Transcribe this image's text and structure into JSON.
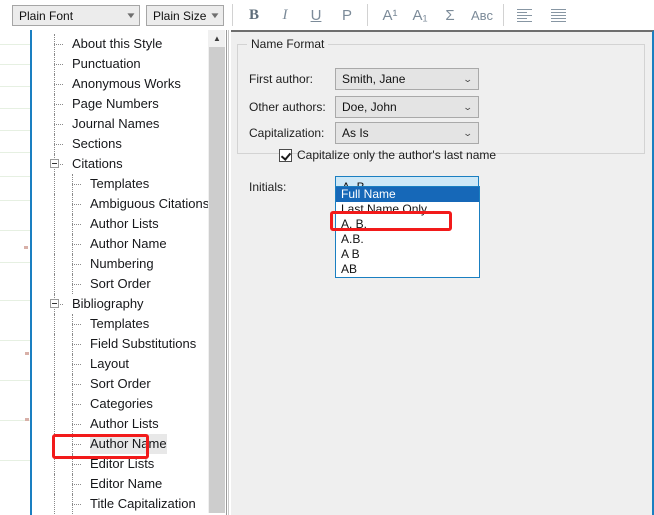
{
  "toolbar": {
    "font_combo": {
      "value": "Plain Font",
      "arrow": "dropdown-arrow-icon"
    },
    "size_combo": {
      "value": "Plain Size",
      "arrow": "dropdown-arrow-icon"
    },
    "buttons": [
      {
        "name": "bold-button",
        "label": "B"
      },
      {
        "name": "italic-button",
        "label": "I"
      },
      {
        "name": "underline-button",
        "label": "U"
      },
      {
        "name": "plain-button",
        "label": "P"
      },
      {
        "name": "superscript-button",
        "label": "A¹"
      },
      {
        "name": "subscript-button",
        "label": "A₁"
      },
      {
        "name": "symbol-button",
        "label": "Σ"
      },
      {
        "name": "spellcheck-button",
        "label": "Aʙᴄ"
      },
      {
        "name": "align-left-button",
        "label": ""
      },
      {
        "name": "align-justify-button",
        "label": ""
      }
    ]
  },
  "tree": {
    "items": [
      {
        "label": "About this Style",
        "level": 1,
        "expander": false,
        "selected": false
      },
      {
        "label": "Punctuation",
        "level": 1,
        "expander": false,
        "selected": false
      },
      {
        "label": "Anonymous Works",
        "level": 1,
        "expander": false,
        "selected": false
      },
      {
        "label": "Page Numbers",
        "level": 1,
        "expander": false,
        "selected": false
      },
      {
        "label": "Journal Names",
        "level": 1,
        "expander": false,
        "selected": false
      },
      {
        "label": "Sections",
        "level": 1,
        "expander": false,
        "selected": false
      },
      {
        "label": "Citations",
        "level": 1,
        "expander": true,
        "selected": false
      },
      {
        "label": "Templates",
        "level": 2,
        "expander": false,
        "selected": false
      },
      {
        "label": "Ambiguous Citations",
        "level": 2,
        "expander": false,
        "selected": false
      },
      {
        "label": "Author Lists",
        "level": 2,
        "expander": false,
        "selected": false
      },
      {
        "label": "Author Name",
        "level": 2,
        "expander": false,
        "selected": false
      },
      {
        "label": "Numbering",
        "level": 2,
        "expander": false,
        "selected": false
      },
      {
        "label": "Sort Order",
        "level": 2,
        "expander": false,
        "selected": false
      },
      {
        "label": "Bibliography",
        "level": 1,
        "expander": true,
        "selected": false
      },
      {
        "label": "Templates",
        "level": 2,
        "expander": false,
        "selected": false
      },
      {
        "label": "Field Substitutions",
        "level": 2,
        "expander": false,
        "selected": false
      },
      {
        "label": "Layout",
        "level": 2,
        "expander": false,
        "selected": false
      },
      {
        "label": "Sort Order",
        "level": 2,
        "expander": false,
        "selected": false
      },
      {
        "label": "Categories",
        "level": 2,
        "expander": false,
        "selected": false
      },
      {
        "label": "Author Lists",
        "level": 2,
        "expander": false,
        "selected": false
      },
      {
        "label": "Author Name",
        "level": 2,
        "expander": false,
        "selected": true
      },
      {
        "label": "Editor Lists",
        "level": 2,
        "expander": false,
        "selected": false
      },
      {
        "label": "Editor Name",
        "level": 2,
        "expander": false,
        "selected": false
      },
      {
        "label": "Title Capitalization",
        "level": 2,
        "expander": false,
        "selected": false
      }
    ],
    "scrollbar": {
      "up_arrow": "scroll-up-arrow-icon"
    }
  },
  "name_format": {
    "legend": "Name Format",
    "first_author": {
      "label": "First author:",
      "value": "Smith, Jane"
    },
    "other_authors": {
      "label": "Other authors:",
      "value": "Doe, John"
    },
    "capitalization": {
      "label": "Capitalization:",
      "value": "As Is"
    },
    "capitalize_last_name": {
      "label": "Capitalize only the author's last name",
      "checked": true
    },
    "initials": {
      "label": "Initials:",
      "value": "A. B.",
      "expanded": true,
      "options": [
        {
          "label": "Full Name",
          "highlighted": true
        },
        {
          "label": "Last Name Only",
          "highlighted": false
        },
        {
          "label": "A. B.",
          "highlighted": false
        },
        {
          "label": "A.B.",
          "highlighted": false
        },
        {
          "label": "A B",
          "highlighted": false
        },
        {
          "label": "AB",
          "highlighted": false
        }
      ]
    }
  },
  "annotations": {
    "accent_color": "#f21a1a",
    "option_box_target": "A. B.",
    "tree_box_target": "Author Name"
  }
}
